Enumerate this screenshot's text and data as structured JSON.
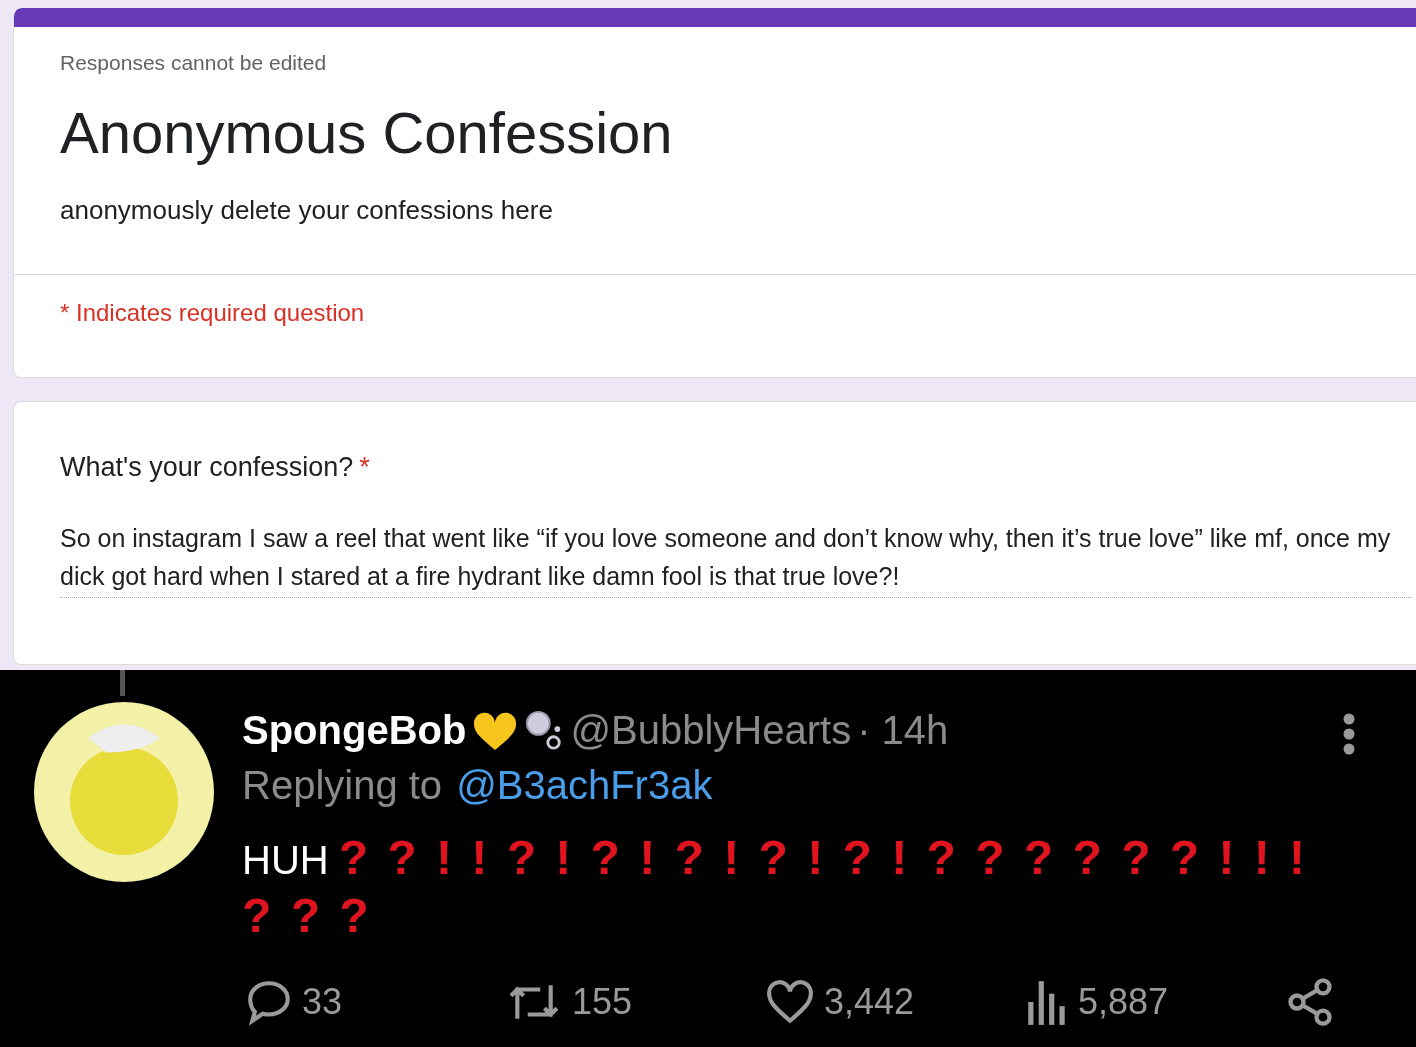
{
  "form_header": {
    "notice": "Responses cannot be edited",
    "title": "Anonymous Confession",
    "description": "anonymously delete your confessions here",
    "required_note": "* Indicates required question"
  },
  "question": {
    "title": "What's your confession?",
    "required_mark": "*",
    "answer": "So on instagram I saw a reel that went like “if you love someone and don’t know why, then it’s true love” like mf, once my dick got hard when I stared at a fire hydrant like damn fool is that true love?!"
  },
  "tweet": {
    "display_name": "SpongeBob",
    "handle": "@BubblyHearts",
    "time": "· 14h",
    "replying_label": "Replying to",
    "replying_to": "@B3achFr3ak",
    "body": "HUH",
    "punctuation": "? ? ! ! ? ! ? ! ? ! ? ! ? ! ? ? ? ? ? ? ! ! ! ? ? ?",
    "actions": [
      {
        "kind": "reply",
        "count": "33"
      },
      {
        "kind": "retweet",
        "count": "155"
      },
      {
        "kind": "like",
        "count": "3,442"
      },
      {
        "kind": "views",
        "count": "5,887"
      },
      {
        "kind": "share"
      }
    ]
  }
}
